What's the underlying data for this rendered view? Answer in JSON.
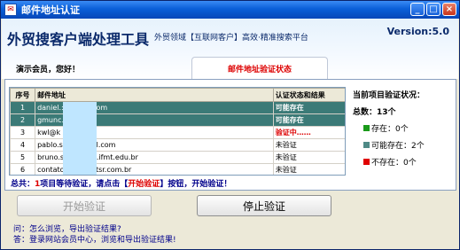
{
  "window": {
    "title": "邮件地址认证",
    "buttons": [
      "_",
      "□",
      "×"
    ]
  },
  "header": {
    "app_title": "外贸搜客户端处理工具",
    "slogan": "外贸领域【互联网客户】高效·精准搜索平台",
    "version": "Version:5.0",
    "greeting": "演示会员，您好！",
    "active_tab": "邮件地址验证状态"
  },
  "table": {
    "columns": [
      "序号",
      "邮件地址",
      "认证状态和结果"
    ],
    "rows": [
      {
        "idx": "1",
        "email": "daniel.:.....mail.com",
        "status": "可能存在",
        "status_type": "possible",
        "selected": true
      },
      {
        "idx": "2",
        "email": "gmunc..... .com",
        "status": "可能存在",
        "status_type": "possible",
        "selected": true
      },
      {
        "idx": "3",
        "email": "kwl@k",
        "status": "验证中……",
        "status_type": "checking",
        "selected": false
      },
      {
        "idx": "4",
        "email": "pablo.s.........mail.com",
        "status": "未验证",
        "status_type": "pending",
        "selected": false
      },
      {
        "idx": "5",
        "email": "bruno.s..........cfs.ifmt.edu.br",
        "status": "未验证",
        "status_type": "pending",
        "selected": false
      },
      {
        "idx": "6",
        "email": "contato............ntsr.com.br",
        "status": "未验证",
        "status_type": "pending",
        "selected": false
      }
    ]
  },
  "summary": {
    "prefix": "总共：",
    "count": "1",
    "middle": "项目等待验证，请点击【",
    "action": "开始验证",
    "suffix": "】按钮，开始验证！"
  },
  "stats": {
    "title": "当前项目验证状况：",
    "total": "总数：13个",
    "legend": [
      {
        "label": "存在：0个",
        "color": "#1a9a1a"
      },
      {
        "label": "可能存在：2个",
        "color": "#4f8a86"
      },
      {
        "label": "不存在：0个",
        "color": "#e00000"
      }
    ]
  },
  "buttons": {
    "start": "开始验证",
    "stop": "停止验证"
  },
  "faq": {
    "question": "问：怎么浏览，导出验证结果?",
    "answer": "答：登录网站会员中心，浏览和导出验证结果!"
  }
}
